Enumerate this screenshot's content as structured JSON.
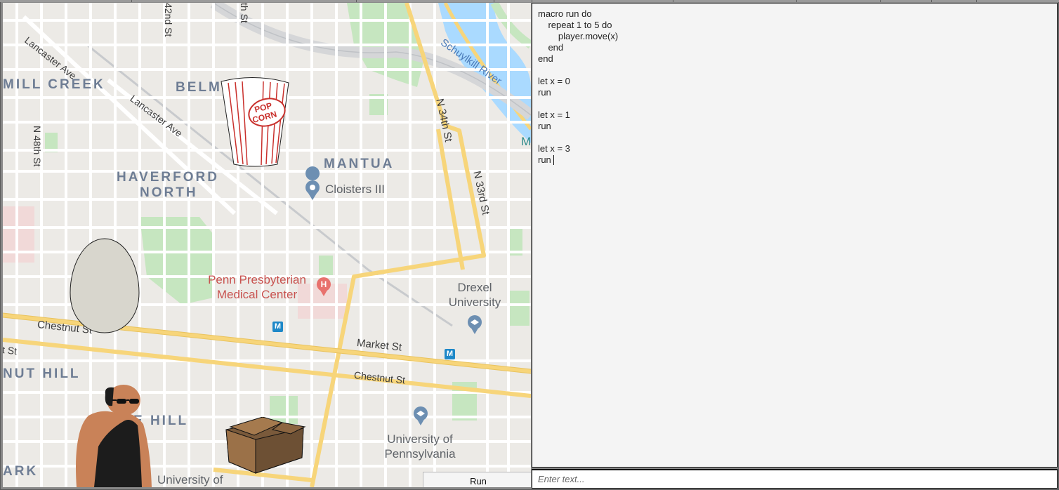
{
  "map": {
    "neighborhoods": [
      "MILL CREEK",
      "BELM",
      "HAVERFORD",
      "NORTH",
      "MANTUA",
      "NUT HILL",
      "E HILL",
      "ARK"
    ],
    "streets": [
      "Lancaster Ave",
      "Lancaster Ave",
      "42nd St",
      "th St",
      "N 48th St",
      "N 34th St",
      "N 33rd St",
      "Chestnut St",
      "Market St",
      "Chestnut St",
      "t St"
    ],
    "places": {
      "cloisters": "Cloisters III",
      "hospital_line1": "Penn Presbyterian",
      "hospital_line2": "Medical Center",
      "hospital_marker": "H",
      "drexel_line1": "Drexel",
      "drexel_line2": "University",
      "upenn_line1": "University of",
      "upenn_line2": "Pennsylvania",
      "upenn_bottom": "University of",
      "river": "Schuylkill River",
      "river_cut": "M",
      "metro": "M"
    },
    "colors": {
      "land": "#eceae6",
      "park": "#c6e6c0",
      "water": "#aadaff",
      "street": "#ffffff",
      "highway": "#f7d57a",
      "neighborhood_text": "#6e7d94",
      "hospital": "#e8716d"
    }
  },
  "sprites": {
    "popcorn_text_1": "POP",
    "popcorn_text_2": "CORN",
    "egg": "egg-sprite",
    "player": "player-sprite",
    "box": "takeout-box-sprite"
  },
  "run_button": {
    "label": "Run"
  },
  "editor": {
    "code": "macro run do\n    repeat 1 to 5 do\n        player.move(x)\n    end\nend\n\nlet x = 0\nrun\n\nlet x = 1\nrun\n\nlet x = 3\nrun"
  },
  "command_input": {
    "placeholder": "Enter text...",
    "value": ""
  }
}
